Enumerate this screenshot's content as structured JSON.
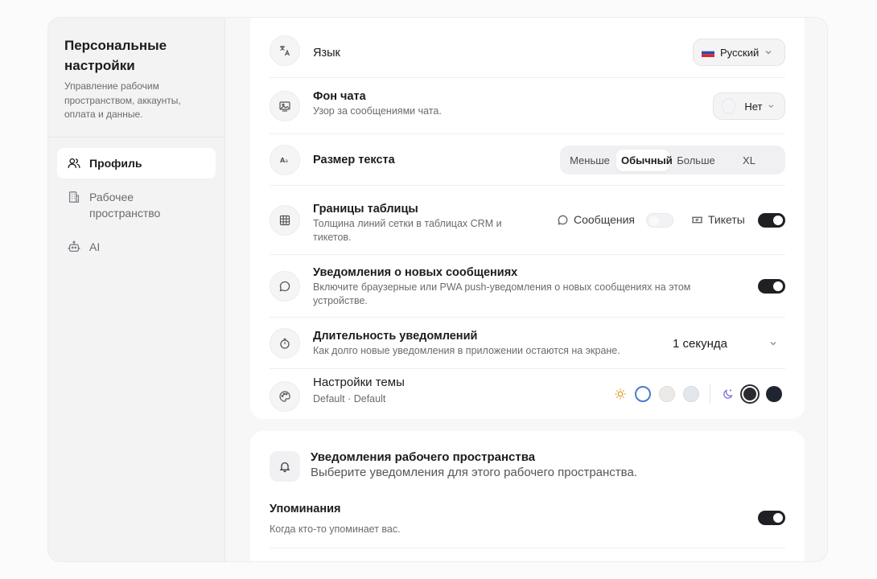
{
  "sidebar": {
    "title": "Персональные настройки",
    "subtitle": "Управление рабочим пространством, аккаунты, оплата и данные.",
    "items": [
      {
        "label": "Профиль",
        "icon": "users-icon",
        "active": true
      },
      {
        "label": "Рабочее пространство",
        "icon": "building-icon",
        "active": false
      },
      {
        "label": "AI",
        "icon": "robot-icon",
        "active": false
      }
    ]
  },
  "language": {
    "title": "Язык",
    "value": "Русский",
    "icon": "translate-icon"
  },
  "chat_bg": {
    "title": "Фон чата",
    "desc": "Узор за сообщениями чата.",
    "value": "Нет",
    "icon": "image-icon"
  },
  "text_size": {
    "title": "Размер текста",
    "options": [
      "Меньше",
      "Обычный",
      "Больше",
      "XL"
    ],
    "selected": "Обычный",
    "icon": "text-size-icon"
  },
  "table_borders": {
    "title": "Границы таблицы",
    "desc": "Толщина линий сетки в таблицах CRM и тикетов.",
    "messages_label": "Сообщения",
    "tickets_label": "Тикеты",
    "messages_on": false,
    "tickets_on": true,
    "icon": "grid-icon"
  },
  "new_msg_notif": {
    "title": "Уведомления о новых сообщениях",
    "desc": "Включите браузерные или PWA push-уведомления о новых сообщениях на этом устройстве.",
    "on": true,
    "icon": "chat-bubble-icon"
  },
  "notif_duration": {
    "title": "Длительность уведомлений",
    "desc": "Как долго новые уведомления в приложении остаются на экране.",
    "value": "1 секунда",
    "icon": "stopwatch-icon"
  },
  "theme": {
    "title": "Настройки темы",
    "desc": "Default · Default",
    "icon": "palette-icon",
    "light_swatches": [
      "#ffffff",
      "#ebeae6",
      "#e3e6ec"
    ],
    "dark_swatches": [
      "#2a2b30",
      "#1f2530"
    ],
    "accent": "#4a7bd0"
  },
  "workspace_notif": {
    "title": "Уведомления рабочего пространства",
    "desc": "Выберите уведомления для этого рабочего пространства.",
    "icon": "bell-icon"
  },
  "mentions": {
    "title": "Упоминания",
    "desc": "Когда кто-то упоминает вас.",
    "on": true
  }
}
